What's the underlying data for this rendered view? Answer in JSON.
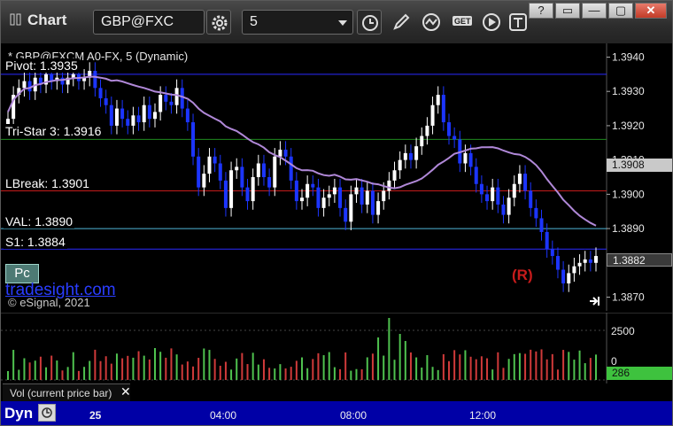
{
  "toolbar": {
    "title": "Chart",
    "symbol": "GBP@FXC",
    "interval": "5"
  },
  "window_buttons": [
    "?",
    "□",
    "—",
    "▢",
    "✕"
  ],
  "chart": {
    "symbol_line": "* GBP@FXCM A0-FX, 5 (Dynamic)",
    "levels": [
      {
        "label": "Pivot: 1.3935",
        "price": 1.3935,
        "color": "#2a2aff"
      },
      {
        "label": "Tri-Star 3: 1.3916",
        "price": 1.3916,
        "color": "#1f8a1f"
      },
      {
        "label": "LBreak: 1.3901",
        "price": 1.3901,
        "color": "#c41c1c"
      },
      {
        "label": "VAL: 1.3890",
        "price": 1.389,
        "color": "#4fb7d8"
      },
      {
        "label": "S1: 1.3884",
        "price": 1.3884,
        "color": "#2a2aff"
      }
    ],
    "pc_button": "Pc",
    "brand": "tradesight.com",
    "copyright": "© eSignal, 2021",
    "marker": "(R)",
    "y_ticks": [
      "1.3940",
      "1.3930",
      "1.3920",
      "1.3910",
      "1.3900",
      "1.3890",
      "1.3880",
      "1.3870"
    ],
    "ma_value": "1.3908",
    "last_price": "1.3882",
    "vol_ticks": [
      "2500",
      "0"
    ],
    "vol_value": "286",
    "vol_label": "Vol (current price bar)",
    "x_ticks": [
      "25",
      "04:00",
      "08:00",
      "12:00"
    ],
    "footer_label": "Dyn"
  },
  "colors": {
    "up_candle": "#ffffff",
    "down_candle": "#1c35ff",
    "ma": "#b088d8",
    "vol_up": "#4fc24f",
    "vol_down": "#d03a3a",
    "footer": "#0000a6"
  },
  "chart_data": {
    "type": "candlestick",
    "y_range": [
      1.3866,
      1.3944
    ],
    "closes": [
      1.3922,
      1.3929,
      1.3931,
      1.3933,
      1.393,
      1.3934,
      1.3932,
      1.3935,
      1.3933,
      1.3934,
      1.3932,
      1.3934,
      1.3935,
      1.3933,
      1.3934,
      1.3936,
      1.3931,
      1.3928,
      1.3926,
      1.392,
      1.3925,
      1.3922,
      1.392,
      1.3923,
      1.3921,
      1.3926,
      1.3922,
      1.3924,
      1.3929,
      1.3927,
      1.3926,
      1.3931,
      1.3925,
      1.3921,
      1.3911,
      1.3902,
      1.3906,
      1.3911,
      1.3909,
      1.3904,
      1.3896,
      1.3907,
      1.3908,
      1.3902,
      1.3898,
      1.3905,
      1.3909,
      1.3905,
      1.3902,
      1.3911,
      1.3913,
      1.3911,
      1.3904,
      1.3898,
      1.3899,
      1.3903,
      1.3902,
      1.3896,
      1.3899,
      1.39,
      1.3902,
      1.3896,
      1.3892,
      1.39,
      1.3902,
      1.3897,
      1.3901,
      1.3894,
      1.3898,
      1.3901,
      1.3904,
      1.3907,
      1.391,
      1.3912,
      1.391,
      1.3914,
      1.3917,
      1.392,
      1.3926,
      1.3929,
      1.3921,
      1.3917,
      1.3916,
      1.3909,
      1.3912,
      1.3908,
      1.3903,
      1.39,
      1.3898,
      1.3902,
      1.3897,
      1.3894,
      1.3899,
      1.3903,
      1.3906,
      1.3901,
      1.3896,
      1.3893,
      1.3889,
      1.3884,
      1.3882,
      1.3878,
      1.3874,
      1.3877,
      1.3879,
      1.388,
      1.3881,
      1.388,
      1.3882
    ]
  }
}
